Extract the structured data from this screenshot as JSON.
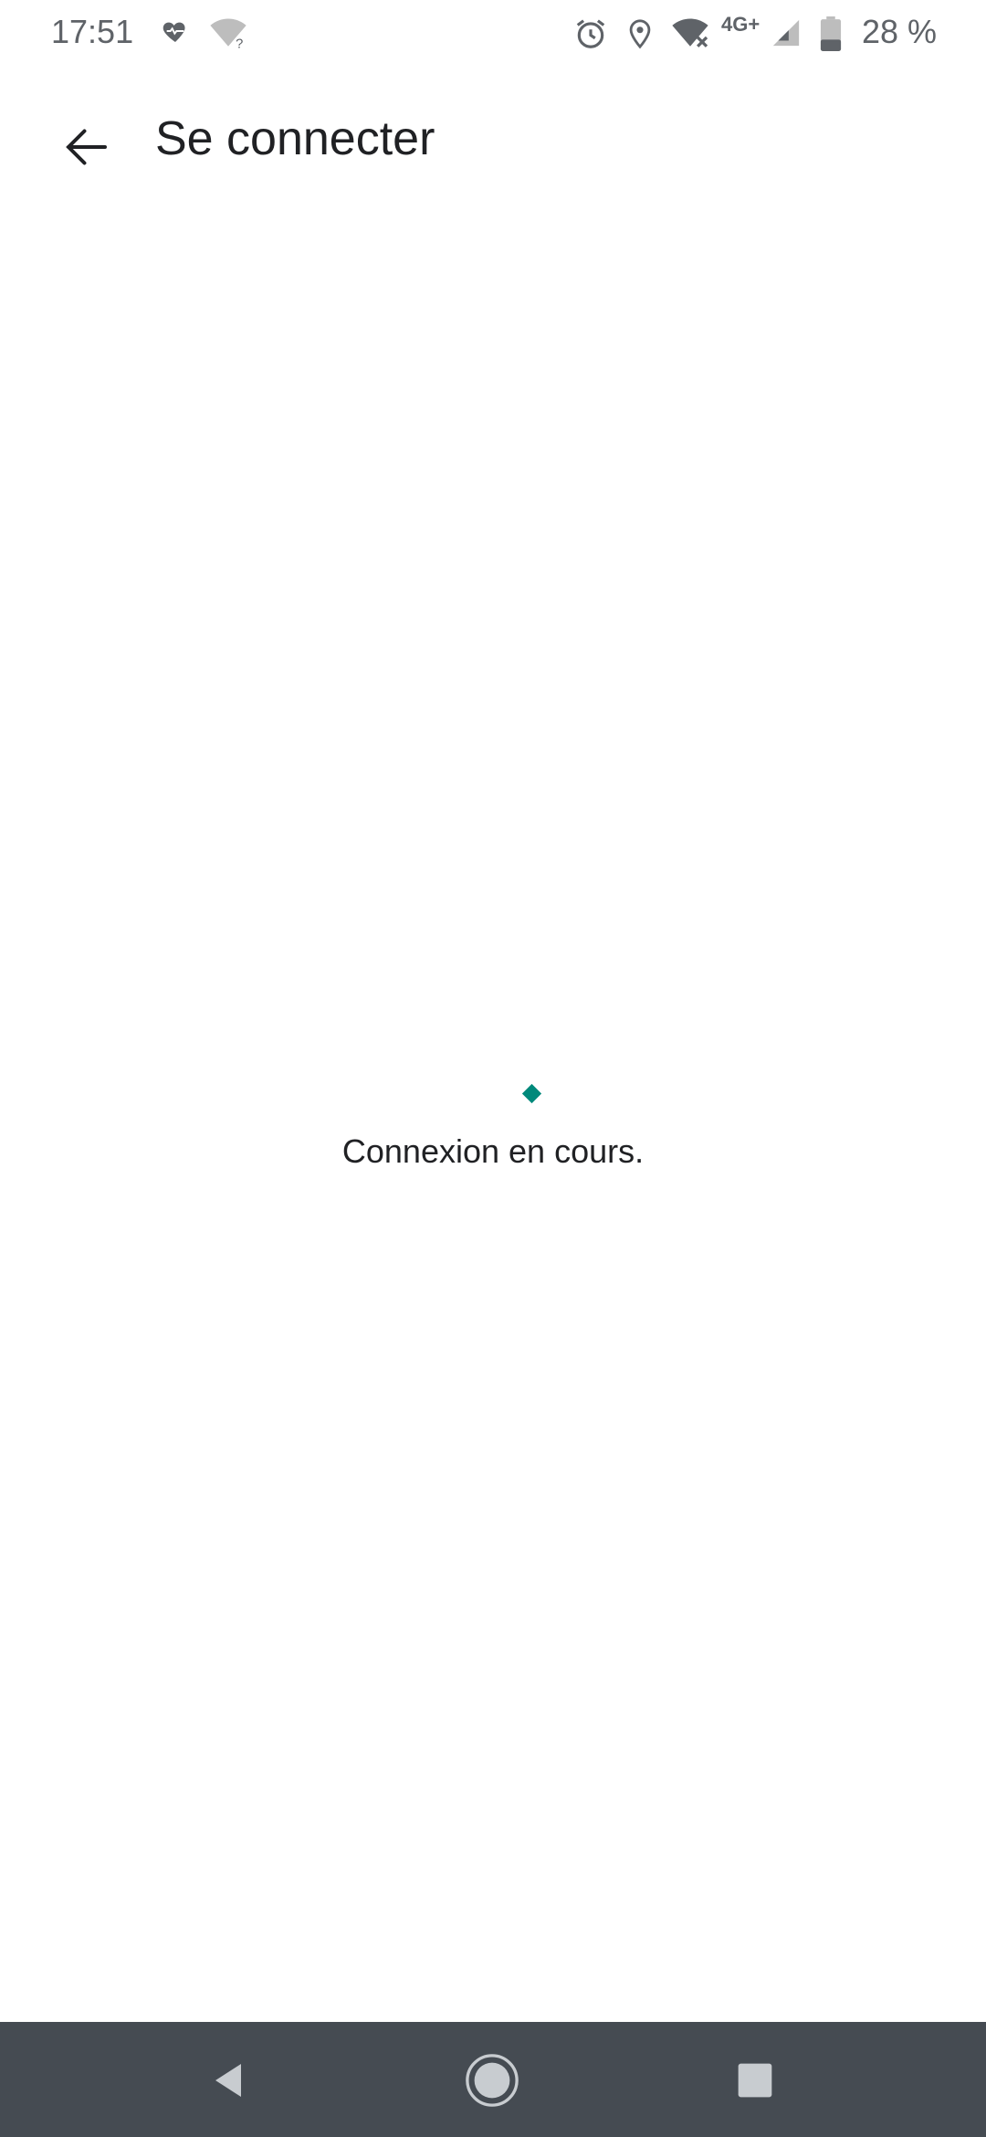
{
  "status_bar": {
    "time": "17:51",
    "battery_percent": "28 %",
    "network_label": "4G+",
    "icons": [
      "heart-rate-icon",
      "wifi-unknown-icon",
      "alarm-icon",
      "location-icon",
      "wifi-off-icon",
      "signal-icon",
      "battery-icon"
    ]
  },
  "app_bar": {
    "title": "Se connecter",
    "back_icon": "arrow-back-icon"
  },
  "main": {
    "status_message": "Connexion en cours.",
    "loader_color": "#00897b"
  },
  "nav_bar": {
    "buttons": [
      "back-triangle-icon",
      "home-circle-icon",
      "recents-square-icon"
    ],
    "background": "#454b52"
  }
}
